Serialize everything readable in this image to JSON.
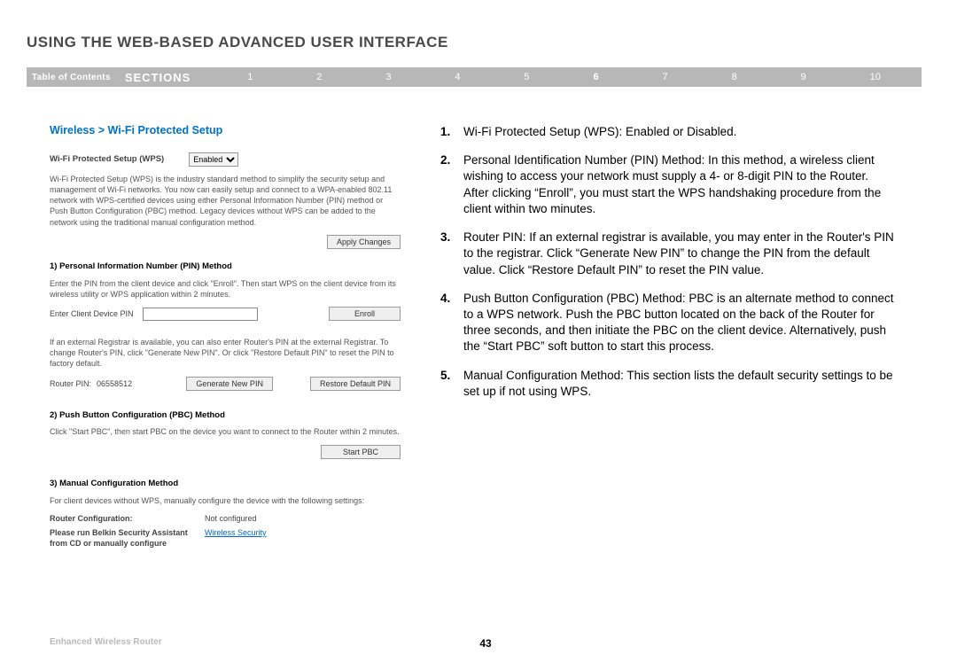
{
  "page_title": "USING THE WEB-BASED ADVANCED USER INTERFACE",
  "nav": {
    "toc": "Table of Contents",
    "sections_label": "SECTIONS",
    "items": [
      "1",
      "2",
      "3",
      "4",
      "5",
      "6",
      "7",
      "8",
      "9",
      "10"
    ],
    "active_index": 5
  },
  "breadcrumb": "Wireless > Wi-Fi Protected Setup",
  "sshot": {
    "wps_label": "Wi-Fi Protected Setup (WPS)",
    "wps_value": "Enabled",
    "intro": "Wi-Fi Protected Setup (WPS) is the industry standard method to simplify the security setup and management of Wi-Fi networks. You now can easily setup and connect to a WPA-enabled 802.11 network with WPS-certified devices using either Personal Information Number (PIN) method or Push Button Configuration (PBC) method. Legacy devices without WPS can be added to the network using the traditional manual configuration method.",
    "apply_btn": "Apply Changes",
    "pin_heading": "1) Personal Information Number (PIN) Method",
    "pin_desc": "Enter the PIN from the client device and click \"Enroll\". Then start WPS on the client device from its wireless utility or WPS application within 2 minutes.",
    "enter_pin_label": "Enter Client Device PIN",
    "enroll_btn": "Enroll",
    "registrar_desc": "If an external Registrar is available, you can also enter Router's PIN at the external Registrar. To change Router's PIN, click \"Generate New PIN\". Or click \"Restore Default PIN\" to reset the PIN to factory default.",
    "router_pin_label": "Router PIN:",
    "router_pin_value": "06558512",
    "gen_pin_btn": "Generate New PIN",
    "restore_pin_btn": "Restore Default PIN",
    "pbc_heading": "2) Push Button Configuration (PBC) Method",
    "pbc_desc": "Click \"Start PBC\", then start PBC on the device you want to connect to the Router within 2 minutes.",
    "start_pbc_btn": "Start PBC",
    "manual_heading": "3) Manual Configuration Method",
    "manual_desc": "For client devices without WPS, manually configure the device with the following settings:",
    "router_conf_label": "Router Configuration:",
    "router_conf_value": "Not configured",
    "please_run_label": "Please run Belkin Security Assistant from CD or manually configure",
    "wireless_security_link": "Wireless Security"
  },
  "instructions": [
    {
      "n": "1.",
      "t": "Wi-Fi Protected Setup (WPS): Enabled or Disabled."
    },
    {
      "n": "2.",
      "t": "Personal Identification Number (PIN) Method: In this method, a wireless client wishing to access your network must supply a 4- or 8-digit PIN to the Router. After clicking “Enroll”, you must start the WPS handshaking procedure from the client within two minutes."
    },
    {
      "n": "3.",
      "t": "Router PIN: If an external registrar is available, you may enter in the Router's PIN to the registrar. Click “Generate New PIN” to change the PIN from the default value. Click “Restore Default PIN” to reset the PIN value."
    },
    {
      "n": "4.",
      "t": "Push Button Configuration (PBC) Method: PBC is an alternate method to connect to a WPS network. Push the PBC button located on the back of the Router for three seconds, and then initiate the PBC on the client device. Alternatively, push the “Start PBC” soft button to start this process."
    },
    {
      "n": "5.",
      "t": "Manual Configuration Method: This section lists the default security settings to be set up if not using WPS."
    }
  ],
  "footer": {
    "product": "Enhanced Wireless Router",
    "page_number": "43"
  }
}
